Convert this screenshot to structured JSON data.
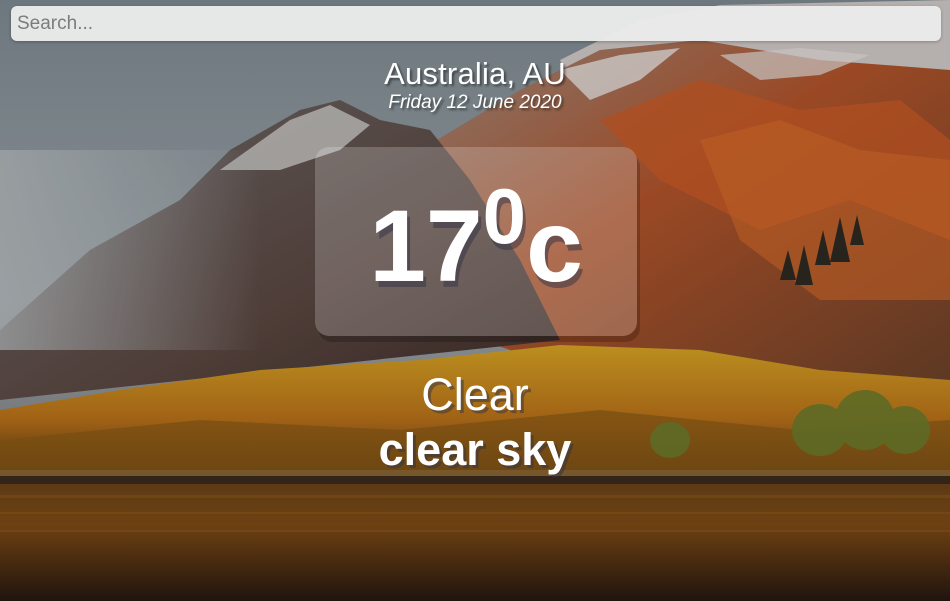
{
  "search": {
    "placeholder": "Search...",
    "value": ""
  },
  "location": {
    "name": "Australia, AU",
    "date": "Friday 12 June 2020"
  },
  "weather": {
    "temperature": "17",
    "degree_symbol": "0",
    "unit": "c",
    "main": "Clear",
    "description": "clear sky"
  },
  "background": {
    "scene": "autumn mountain lake landscape",
    "sky_color": "#8e9aa3",
    "mountain_color": "#6b5048",
    "foliage_color": "#c98a1c",
    "water_color": "#4a2a12"
  }
}
